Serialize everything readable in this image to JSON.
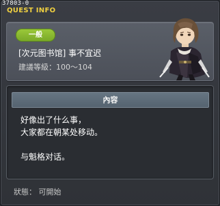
{
  "window": {
    "quest_id": "37803-0",
    "title": "QUEST INFO"
  },
  "quest": {
    "category_badge": "一般",
    "name": "[次元图书馆] 事不宜迟",
    "level_requirement": "建議等級：100～104"
  },
  "content": {
    "header": "內容",
    "lines": [
      "好像出了什么事，",
      "大家都在朝某处移动。",
      "与魁格对话。"
    ]
  },
  "status": {
    "text": "狀態： 可開始"
  },
  "colors": {
    "title_yellow": "#f0d040",
    "badge_green": "#8ab832",
    "panel_gray": "#535861",
    "header_blue": "#5e6c79"
  }
}
